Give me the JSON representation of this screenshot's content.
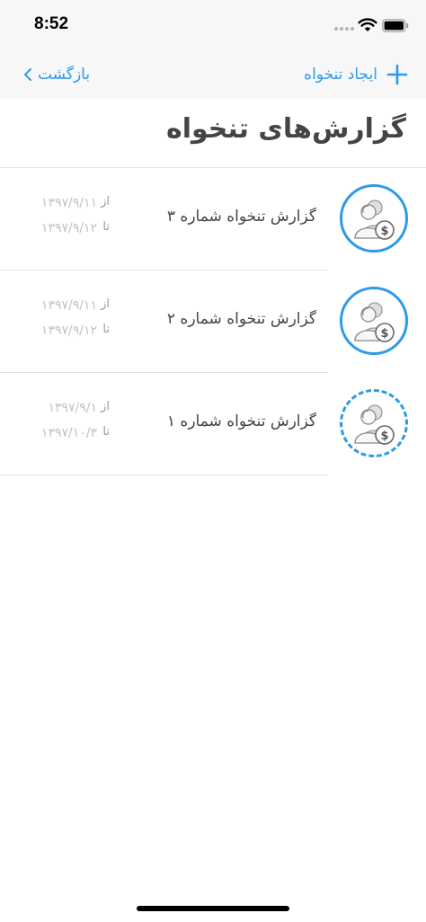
{
  "status_bar": {
    "time": "8:52"
  },
  "nav": {
    "back_label": "بازگشت",
    "create_label": "ایجاد تنخواه"
  },
  "page": {
    "title": "گزارش‌های تنخواه"
  },
  "reports": [
    {
      "title": "گزارش تنخواه شماره ۳",
      "from_label": "از",
      "from_date": "۱۳۹۷/۹/۱۱",
      "to_label": "تا",
      "to_date": "۱۳۹۷/۹/۱۲"
    },
    {
      "title": "گزارش تنخواه شماره ۲",
      "from_label": "از",
      "from_date": "۱۳۹۷/۹/۱۱",
      "to_label": "تا",
      "to_date": "۱۳۹۷/۹/۱۲"
    },
    {
      "title": "گزارش تنخواه شماره ۱",
      "from_label": "از",
      "from_date": "۱۳۹۷/۹/۱",
      "to_label": "تا",
      "to_date": "۱۳۹۷/۱۰/۳"
    }
  ],
  "colors": {
    "accent": "#2e9be6",
    "nav_background": "#f7f7f7",
    "divider": "#e3e3e3"
  },
  "icons": {
    "avatar": "person-money-icon",
    "back": "chevron-left-icon",
    "create": "plus-icon"
  }
}
